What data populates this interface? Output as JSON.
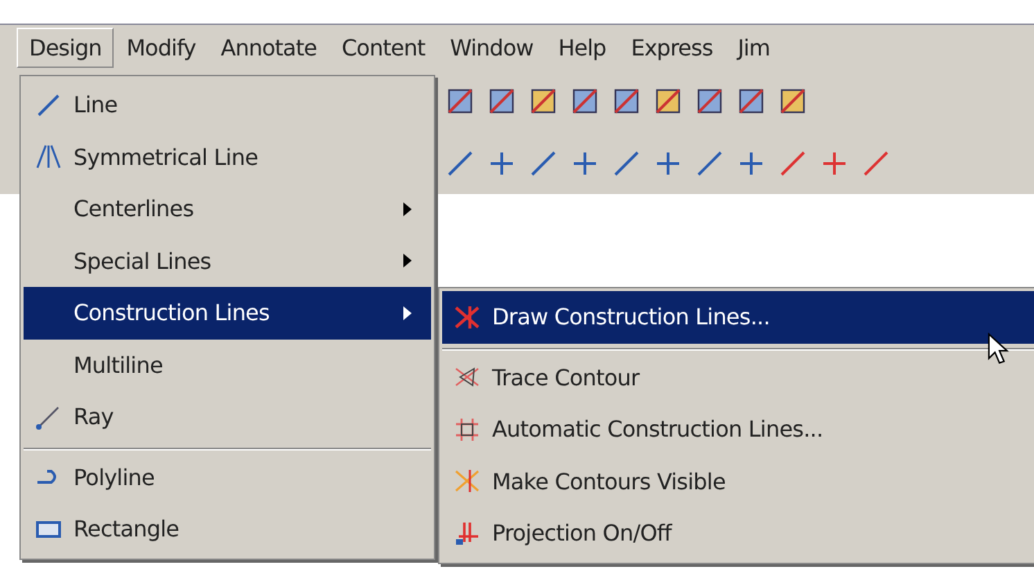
{
  "menu_bar": [
    {
      "label": "Design",
      "selected": true
    },
    {
      "label": "Modify",
      "selected": false
    },
    {
      "label": "Annotate",
      "selected": false
    },
    {
      "label": "Content",
      "selected": false
    },
    {
      "label": "Window",
      "selected": false
    },
    {
      "label": "Help",
      "selected": false
    },
    {
      "label": "Express",
      "selected": false
    },
    {
      "label": "Jim",
      "selected": false
    }
  ],
  "design_menu": [
    {
      "label": "Line",
      "kind": "line",
      "selected": false,
      "submenu": false
    },
    {
      "label": "Symmetrical Line",
      "kind": "symmetric",
      "selected": false,
      "submenu": false
    },
    {
      "label": "Centerlines",
      "kind": "plain",
      "selected": false,
      "submenu": true
    },
    {
      "label": "Special Lines",
      "kind": "plain",
      "selected": false,
      "submenu": true
    },
    {
      "label": "Construction Lines",
      "kind": "plain",
      "selected": true,
      "submenu": true
    },
    {
      "label": "Multiline",
      "kind": "plain",
      "selected": false,
      "submenu": false
    },
    {
      "label": "Ray",
      "kind": "ray",
      "selected": false,
      "submenu": false,
      "separator_after": true
    },
    {
      "label": "Polyline",
      "kind": "polyline",
      "selected": false,
      "submenu": false
    },
    {
      "label": "Rectangle",
      "kind": "rectangle",
      "selected": false,
      "submenu": false
    }
  ],
  "construction_submenu": [
    {
      "label": "Draw Construction Lines...",
      "kind": "draw",
      "selected": true,
      "separator_after": true
    },
    {
      "label": "Trace Contour",
      "kind": "trace",
      "selected": false
    },
    {
      "label": "Automatic Construction Lines...",
      "kind": "auto",
      "selected": false
    },
    {
      "label": "Make Contours Visible",
      "kind": "visible",
      "selected": false
    },
    {
      "label": "Projection On/Off",
      "kind": "projection",
      "selected": false
    }
  ]
}
